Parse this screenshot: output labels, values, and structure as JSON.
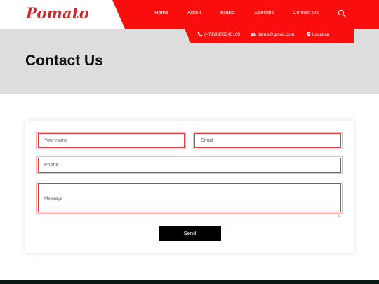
{
  "brand": {
    "logo_text": "Pomato"
  },
  "nav": {
    "items": [
      {
        "label": "Home"
      },
      {
        "label": "About"
      },
      {
        "label": "Brand"
      },
      {
        "label": "Specials"
      },
      {
        "label": "Contact Us"
      }
    ]
  },
  "info": {
    "phone": "(+71)9876543109",
    "email": "demo@gmail.com",
    "location": "Location"
  },
  "hero": {
    "title": "Contact Us"
  },
  "form": {
    "name_placeholder": "Your name",
    "email_placeholder": "Email",
    "phone_placeholder": "Phone",
    "message_placeholder": "Message",
    "send_label": "Send"
  },
  "colors": {
    "accent": "#fa0d0d",
    "logo": "#c62a2a",
    "hero_bg": "#dddddd",
    "field_border": "#e23d3d",
    "button_bg": "#000000",
    "footer": "#0a1a12"
  },
  "icons": [
    "search-icon",
    "phone-icon",
    "email-icon",
    "location-icon"
  ]
}
